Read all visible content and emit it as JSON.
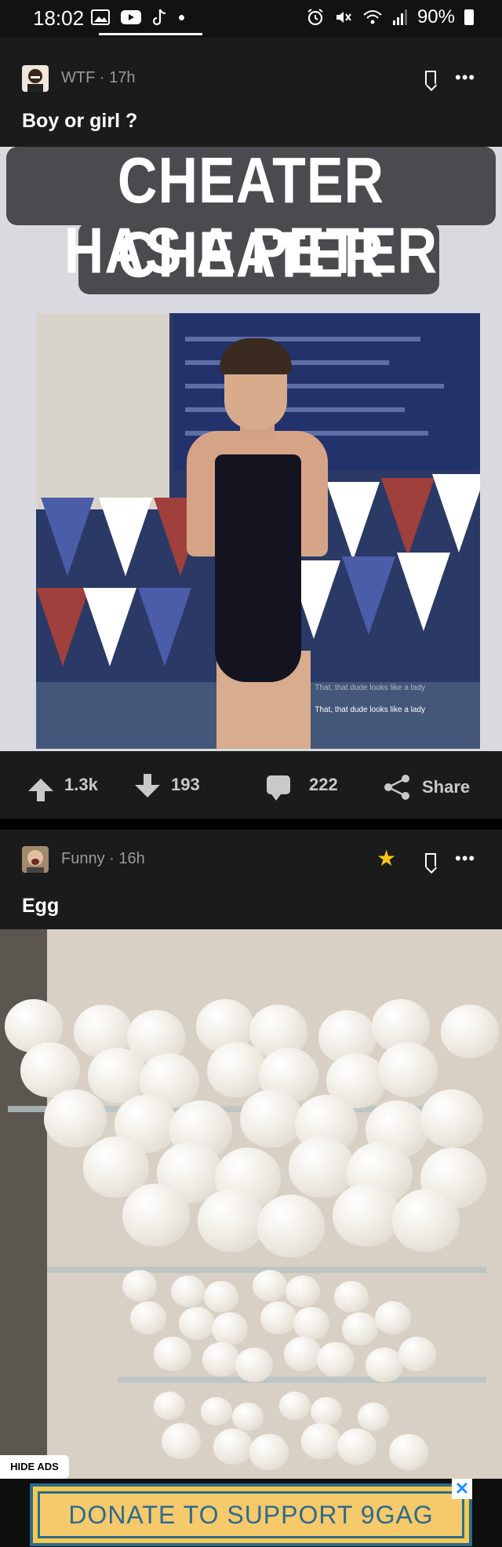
{
  "status_bar": {
    "time": "18:02",
    "battery": "90%"
  },
  "posts": [
    {
      "section": "WTF",
      "age": "17h",
      "title": "Boy or girl ?",
      "meme_caption_line1": "CHEATER CHEATER",
      "meme_caption_line2": "HAS A PETER",
      "watermark_1": "That, that dude looks like a lady",
      "watermark_2": "That, that dude looks like a lady",
      "upvotes": "1.3k",
      "downvotes": "193",
      "comments": "222",
      "share_label": "Share"
    },
    {
      "section": "Funny",
      "age": "16h",
      "title": "Egg"
    }
  ],
  "ads": {
    "hide_label": "HIDE ADS",
    "banner_text": "DONATE TO SUPPORT 9GAG",
    "close_label": "✕"
  },
  "colors": {
    "background": "#1b1b1b",
    "star": "#f5c518",
    "ad_text": "#2d6b8f"
  }
}
